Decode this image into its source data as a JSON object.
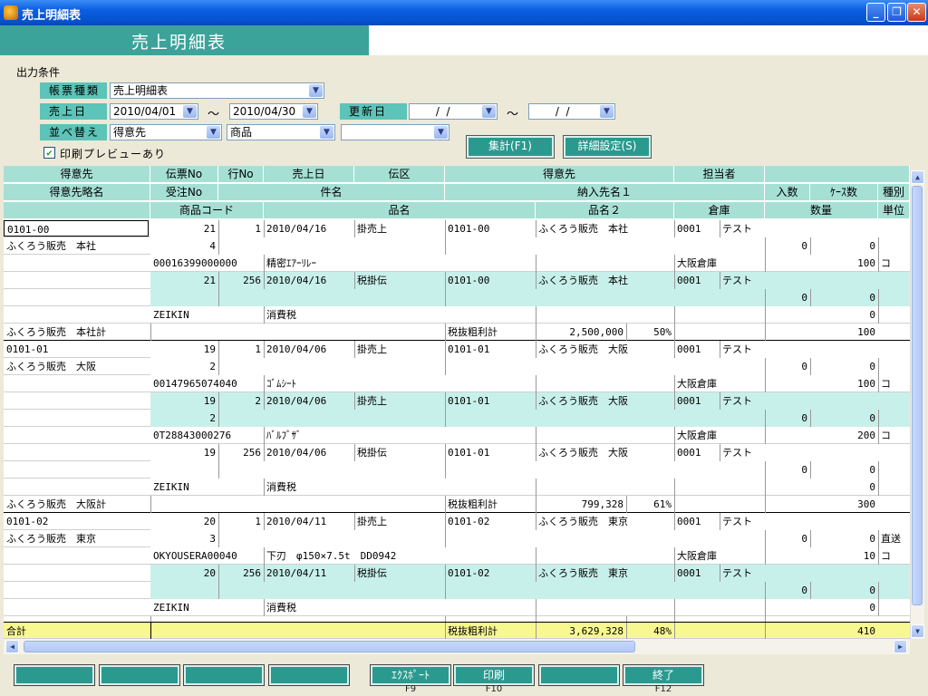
{
  "window": {
    "title": "売上明細表"
  },
  "header": {
    "title": "売上明細表"
  },
  "conditions": {
    "section_label": "出力条件",
    "report_type_label": "帳票種類",
    "report_type_value": "売上明細表",
    "sales_date_label": "売上日",
    "sales_date_from": "2010/04/01",
    "sales_date_to": "2010/04/30",
    "range_sep": "～",
    "update_date_label": "更新日",
    "update_date_from": " /  / ",
    "update_date_to": " /  / ",
    "sort_label": "並べ替え",
    "sort1": "得意先",
    "sort2": "商品",
    "sort3": "",
    "preview_label": "印刷プレビューあり",
    "preview_checked": true,
    "aggregate_button": "集計(F1)",
    "detail_button": "詳細設定(S)"
  },
  "grid": {
    "header_row1": [
      "得意先",
      "伝票No",
      "行No",
      "売上日",
      "伝区",
      "得意先",
      "担当者",
      ""
    ],
    "header_row2": [
      "得意先略名",
      "受注No",
      "件名",
      "納入先名１",
      "入数",
      "ｹｰｽ数",
      "種別"
    ],
    "header_row3": [
      "",
      "商品コード",
      "品名",
      "品名２",
      "倉庫",
      "数量",
      "単位"
    ],
    "groups": [
      {
        "code": "0101-00",
        "name": "ふくろう販売　本社",
        "subtotal_label": "ふくろう販売　本社計",
        "subtotal_tag": "税抜粗利計",
        "subtotal_amount": "2,500,000",
        "subtotal_rate": "50%",
        "subtotal_qty": "100",
        "slips": [
          {
            "slip": "21",
            "line": "1",
            "date": "2010/04/16",
            "kind": "掛売上",
            "cust_code": "0101-00",
            "cust_name": "ふくろう販売　本社",
            "staff_code": "0001",
            "staff": "テスト",
            "order": "4",
            "irisu": "0",
            "cases": "0",
            "type": "",
            "item_code": "00016399000000",
            "item": "精密ｴｱｰﾘﾚｰ",
            "warehouse": "大阪倉庫",
            "qty": "100",
            "unit": "コ"
          },
          {
            "slip": "21",
            "line": "256",
            "date": "2010/04/16",
            "kind": "税掛伝",
            "cust_code": "0101-00",
            "cust_name": "ふくろう販売　本社",
            "staff_code": "0001",
            "staff": "テスト",
            "order": "",
            "irisu": "0",
            "cases": "0",
            "type": "",
            "item_code": "ZEIKIN",
            "item": "消費税",
            "warehouse": "",
            "qty": "0",
            "unit": ""
          }
        ]
      },
      {
        "code": "0101-01",
        "name": "ふくろう販売　大阪",
        "subtotal_label": "ふくろう販売　大阪計",
        "subtotal_tag": "税抜粗利計",
        "subtotal_amount": "799,328",
        "subtotal_rate": "61%",
        "subtotal_qty": "300",
        "slips": [
          {
            "slip": "19",
            "line": "1",
            "date": "2010/04/06",
            "kind": "掛売上",
            "cust_code": "0101-01",
            "cust_name": "ふくろう販売　大阪",
            "staff_code": "0001",
            "staff": "テスト",
            "order": "2",
            "irisu": "0",
            "cases": "0",
            "type": "",
            "item_code": "00147965074040",
            "item": "ｺﾞﾑｼｰﾄ",
            "warehouse": "大阪倉庫",
            "qty": "100",
            "unit": "コ"
          },
          {
            "slip": "19",
            "line": "2",
            "date": "2010/04/06",
            "kind": "掛売上",
            "cust_code": "0101-01",
            "cust_name": "ふくろう販売　大阪",
            "staff_code": "0001",
            "staff": "テスト",
            "order": "2",
            "irisu": "0",
            "cases": "0",
            "type": "",
            "item_code": "0T28843000276",
            "item": "ﾊﾞﾙﾌﾞｻﾞ",
            "warehouse": "大阪倉庫",
            "qty": "200",
            "unit": "コ"
          },
          {
            "slip": "19",
            "line": "256",
            "date": "2010/04/06",
            "kind": "税掛伝",
            "cust_code": "0101-01",
            "cust_name": "ふくろう販売　大阪",
            "staff_code": "0001",
            "staff": "テスト",
            "order": "",
            "irisu": "0",
            "cases": "0",
            "type": "",
            "item_code": "ZEIKIN",
            "item": "消費税",
            "warehouse": "",
            "qty": "0",
            "unit": ""
          }
        ]
      },
      {
        "code": "0101-02",
        "name": "ふくろう販売　東京",
        "subtotal_label": "",
        "subtotal_tag": "",
        "subtotal_amount": "",
        "subtotal_rate": "",
        "subtotal_qty": "",
        "slips": [
          {
            "slip": "20",
            "line": "1",
            "date": "2010/04/11",
            "kind": "掛売上",
            "cust_code": "0101-02",
            "cust_name": "ふくろう販売　東京",
            "staff_code": "0001",
            "staff": "テスト",
            "order": "3",
            "irisu": "0",
            "cases": "0",
            "type": "直送",
            "item_code": "OKYOUSERA00040",
            "item": "下刃　φ150×7.5t　DD0942",
            "warehouse": "大阪倉庫",
            "qty": "10",
            "unit": "コ"
          },
          {
            "slip": "20",
            "line": "256",
            "date": "2010/04/11",
            "kind": "税掛伝",
            "cust_code": "0101-02",
            "cust_name": "ふくろう販売　東京",
            "staff_code": "0001",
            "staff": "テスト",
            "order": "",
            "irisu": "0",
            "cases": "0",
            "type": "",
            "item_code": "ZEIKIN",
            "item": "消費税",
            "warehouse": "",
            "qty": "0",
            "unit": ""
          }
        ]
      }
    ],
    "total": {
      "label": "合計",
      "tag": "税抜粗利計",
      "amount": "3,629,328",
      "rate": "48%",
      "qty": "410"
    }
  },
  "footer": {
    "buttons": [
      {
        "label": "",
        "key": ""
      },
      {
        "label": "",
        "key": ""
      },
      {
        "label": "",
        "key": ""
      },
      {
        "label": "",
        "key": ""
      },
      {
        "label": "ｴｸｽﾎﾟｰﾄ",
        "key": "F9"
      },
      {
        "label": "印刷",
        "key": "F10"
      },
      {
        "label": "",
        "key": ""
      },
      {
        "label": "終了",
        "key": "F12"
      }
    ]
  },
  "colors": {
    "title_band": "#3ba39a",
    "label_bg": "#5cc4b8",
    "header_cell": "#a6e0d5",
    "slip_row": "#c8f0ea",
    "total_row": "#f8f890",
    "button": "#2a9a8f"
  }
}
